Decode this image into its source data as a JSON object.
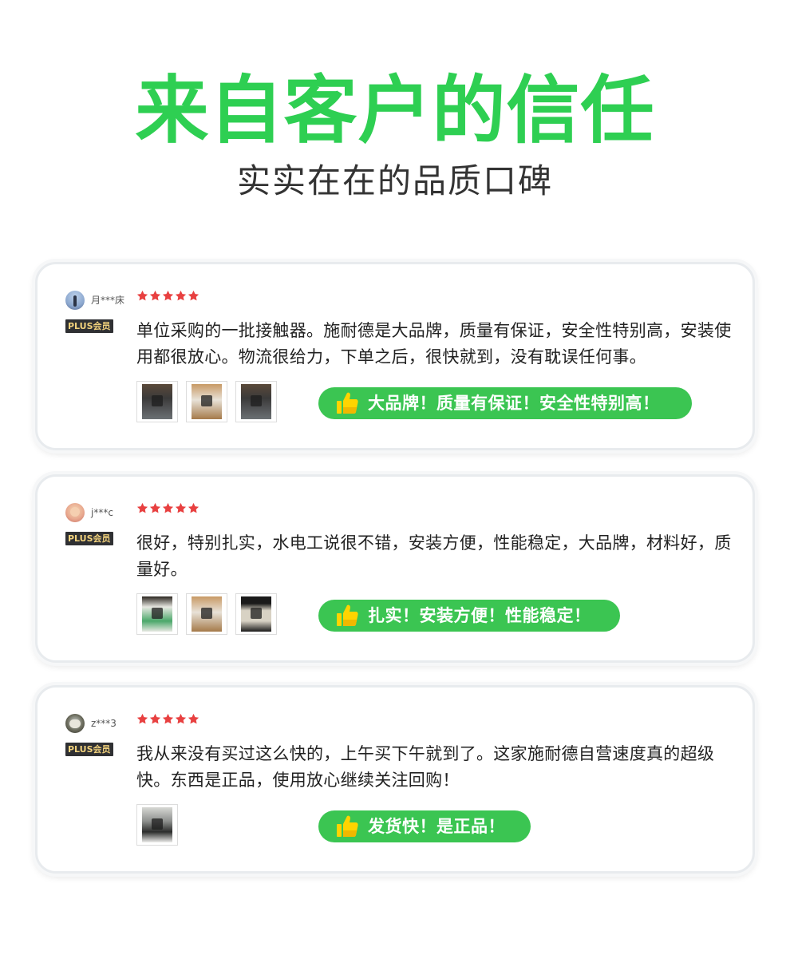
{
  "header": {
    "title": "来自客户的信任",
    "subtitle": "实实在在的品质口碑"
  },
  "colors": {
    "accent_green": "#2ecf52",
    "pill_green": "#3bc552",
    "star_red": "#e84040",
    "badge_bg": "#2f3033",
    "badge_text": "#f1d17c"
  },
  "reviews": [
    {
      "username": "月***床",
      "badge": "PLUS会员",
      "rating": 5,
      "text": "单位采购的一批接触器。施耐德是大品牌，质量有保证，安全性特别高，安装使用都很放心。物流很给力，下单之后，很快就到，没有耽误任何事。",
      "photo_count": 3,
      "highlight": "大品牌！质量有保证！安全性特别高！",
      "highlight_icon": "thumbs-up-icon"
    },
    {
      "username": "j***c",
      "badge": "PLUS会员",
      "rating": 5,
      "text": "很好，特别扎实，水电工说很不错，安装方便，性能稳定，大品牌，材料好，质量好。",
      "photo_count": 3,
      "highlight": "扎实！安装方便！性能稳定！",
      "highlight_icon": "thumbs-up-icon"
    },
    {
      "username": "z***3",
      "badge": "PLUS会员",
      "rating": 5,
      "text": "我从来没有买过这么快的，上午买下午就到了。这家施耐德自营速度真的超级快。东西是正品，使用放心继续关注回购！",
      "photo_count": 1,
      "highlight": "发货快！是正品！",
      "highlight_icon": "thumbs-up-icon"
    }
  ]
}
